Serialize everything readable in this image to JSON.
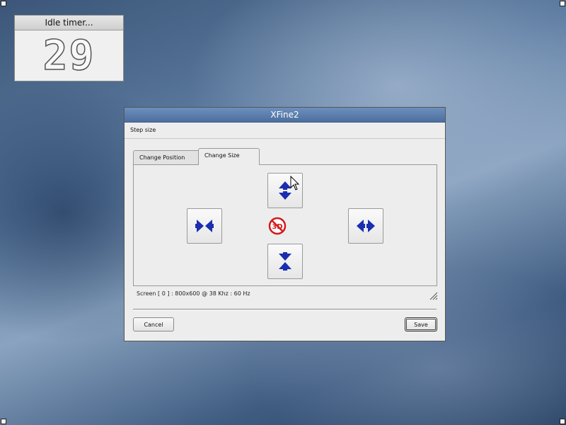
{
  "idle_timer": {
    "title": "Idle timer...",
    "value": "29"
  },
  "dialog": {
    "title": "XFine2",
    "menu": "Step size",
    "tabs": [
      "Change Position",
      "Change Size"
    ],
    "active_tab": "Change Size",
    "buttons": {
      "increase_height": "arrows-up-down-icon",
      "decrease_width": "arrows-inward-horizontal-icon",
      "increase_width": "arrows-outward-horizontal-icon",
      "decrease_height": "arrows-inward-vertical-icon",
      "no_3d": "no-3d-icon"
    },
    "status": "Screen [ 0 ] : 800x600 @ 38 Khz : 60 Hz",
    "cancel_label": "Cancel",
    "save_label": "Save"
  },
  "colors": {
    "titlebar": "#5a7cab",
    "arrow": "#1a2eb0",
    "no3d": "#d21a1a"
  }
}
